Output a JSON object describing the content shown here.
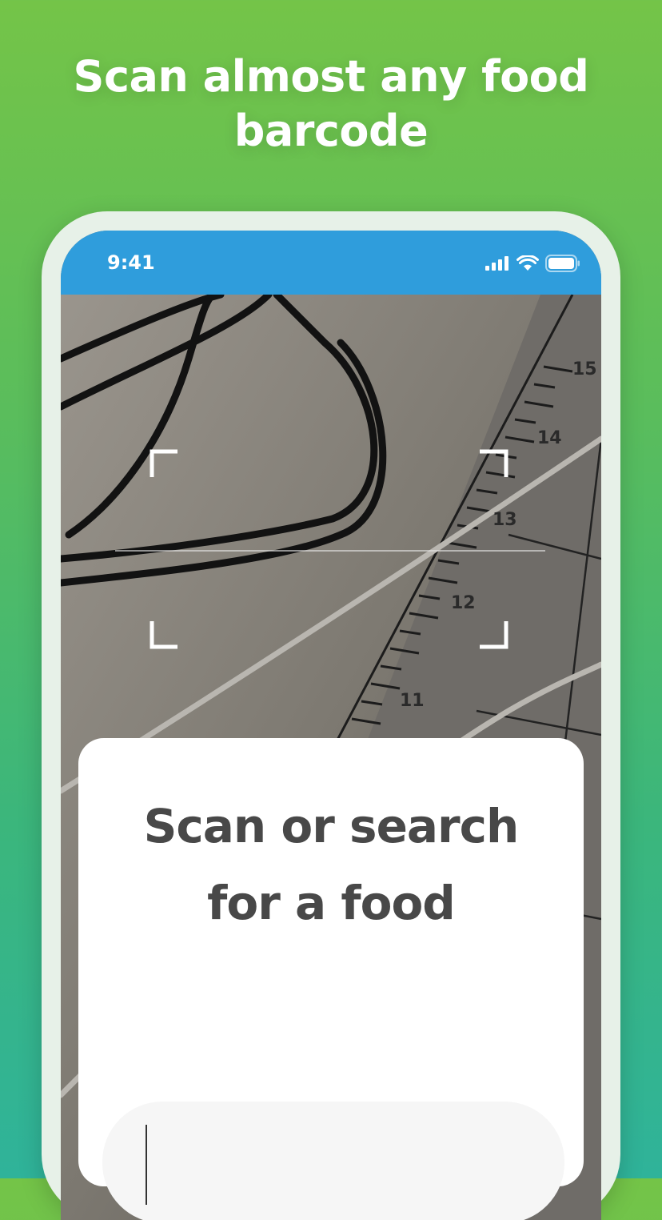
{
  "headline": {
    "line1": "Scan almost any food",
    "line2": "barcode"
  },
  "status_bar": {
    "time": "9:41",
    "icons": [
      "cellular-signal-icon",
      "wifi-icon",
      "battery-icon"
    ],
    "color": "#2f9ddc"
  },
  "scanner": {
    "icons": [
      "scan-frame-corner-icon"
    ]
  },
  "card": {
    "title_line1": "Scan or search",
    "title_line2": "for a food",
    "search_placeholder": ""
  },
  "colors": {
    "background_top": "#74c448",
    "background_bottom": "#2fb39a",
    "title_text": "#484848"
  }
}
